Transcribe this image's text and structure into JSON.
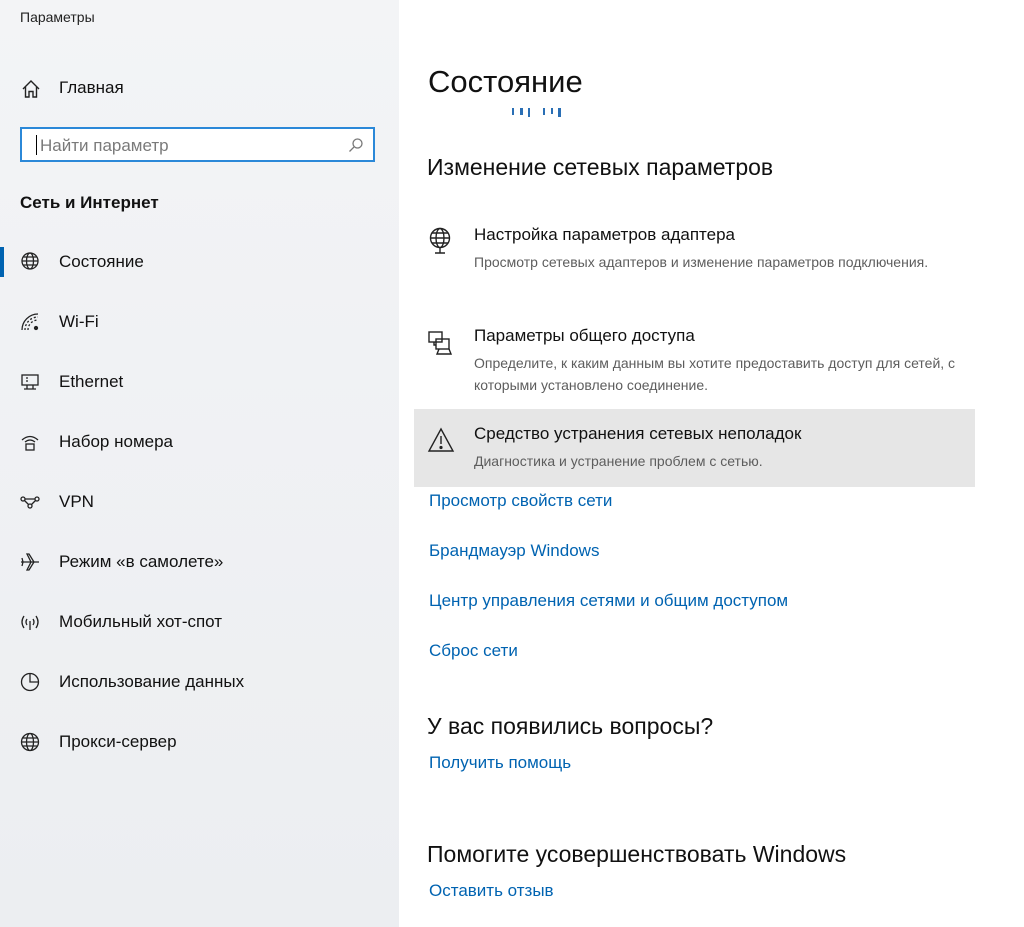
{
  "window": {
    "title": "Параметры"
  },
  "sidebar": {
    "home_label": "Главная",
    "search": {
      "placeholder": "Найти параметр",
      "value": ""
    },
    "section_title": "Сеть и Интернет",
    "items": [
      {
        "label": "Состояние",
        "icon": "globe-status-icon",
        "selected": true
      },
      {
        "label": "Wi-Fi",
        "icon": "wifi-icon"
      },
      {
        "label": "Ethernet",
        "icon": "ethernet-icon"
      },
      {
        "label": "Набор номера",
        "icon": "dialup-icon"
      },
      {
        "label": "VPN",
        "icon": "vpn-icon"
      },
      {
        "label": "Режим «в самолете»",
        "icon": "airplane-icon"
      },
      {
        "label": "Мобильный хот-спот",
        "icon": "hotspot-icon"
      },
      {
        "label": "Использование данных",
        "icon": "data-usage-icon"
      },
      {
        "label": "Прокси-сервер",
        "icon": "globe-icon"
      }
    ]
  },
  "main": {
    "title": "Состояние",
    "change_heading": "Изменение сетевых параметров",
    "options": [
      {
        "title": "Настройка параметров адаптера",
        "desc": "Просмотр сетевых адаптеров и изменение параметров подключения.",
        "icon": "adapter-globe-icon"
      },
      {
        "title": "Параметры общего доступа",
        "desc": "Определите, к каким данным вы хотите предоставить доступ для сетей, с которыми установлено соединение.",
        "icon": "sharing-icon"
      },
      {
        "title": "Средство устранения сетевых неполадок",
        "desc": "Диагностика и устранение проблем с сетью.",
        "icon": "warning-icon",
        "highlighted": true
      }
    ],
    "links": [
      "Просмотр свойств сети",
      "Брандмауэр Windows",
      "Центр управления сетями и общим доступом",
      "Сброс сети"
    ],
    "questions_heading": "У вас появились вопросы?",
    "help_link": "Получить помощь",
    "improve_heading": "Помогите усовершенствовать Windows",
    "feedback_link": "Оставить отзыв"
  },
  "colors": {
    "accent": "#0063b1",
    "search_border": "#2b88d8",
    "highlight": "#e6e6e6",
    "sidebar_bg": "#f0f1f3"
  }
}
